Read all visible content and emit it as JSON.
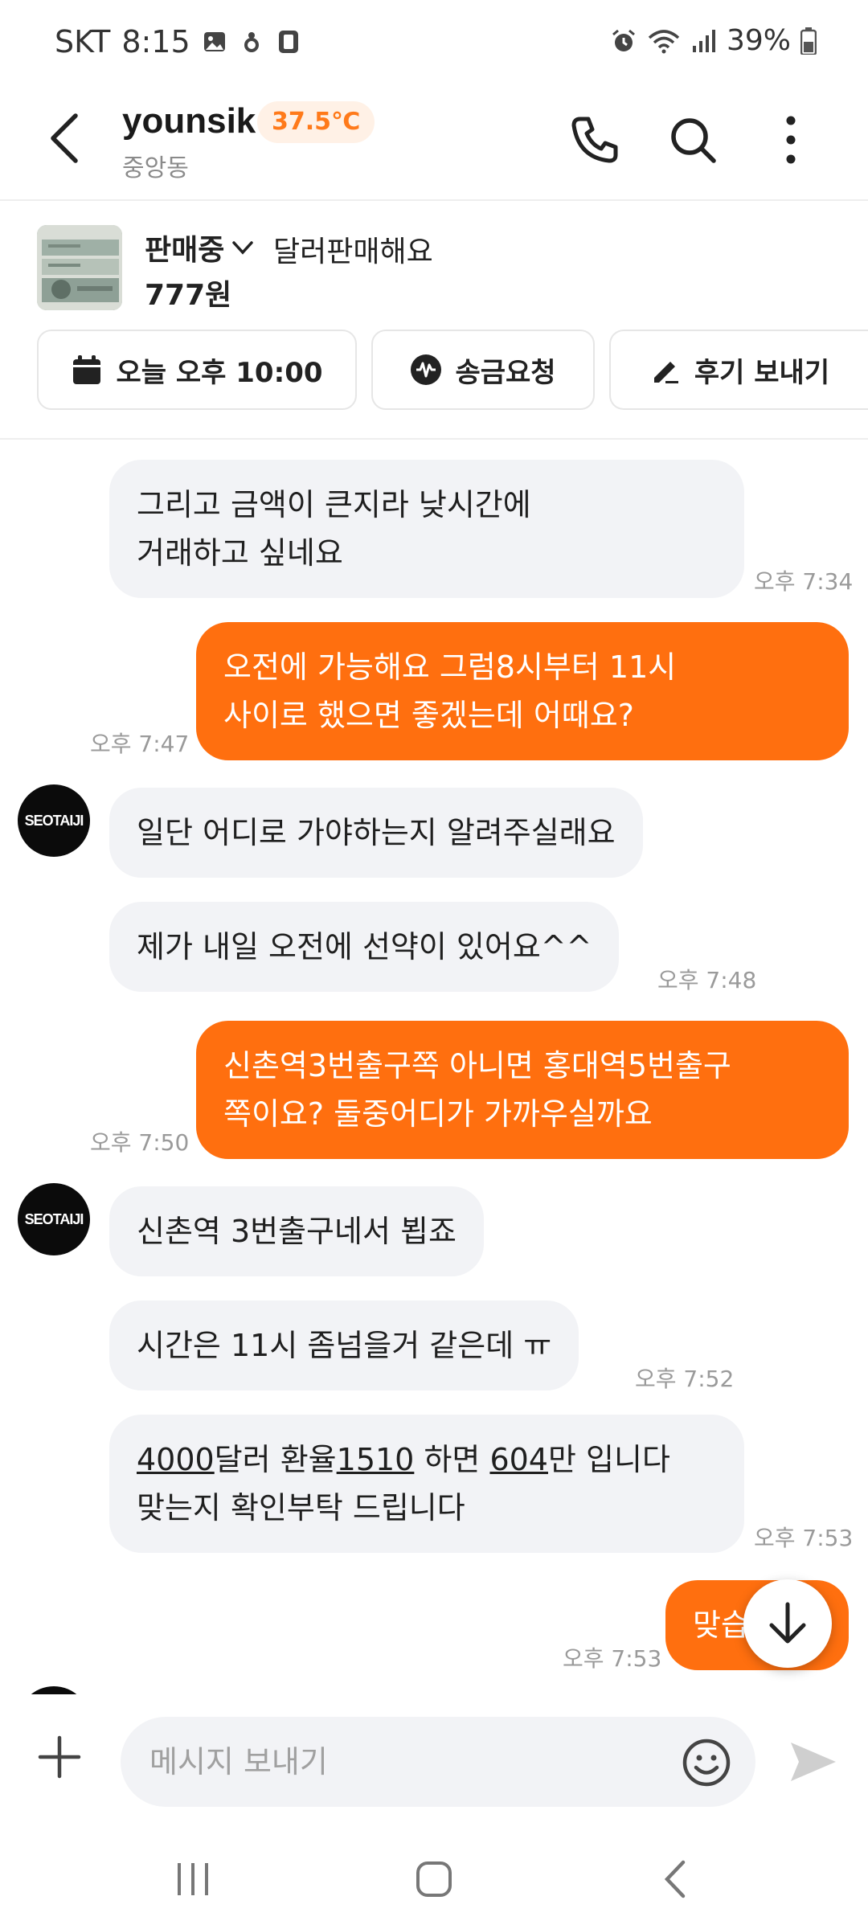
{
  "status_bar": {
    "carrier": "SKT",
    "time": "8:15",
    "battery": "39%"
  },
  "header": {
    "user_name": "younsik",
    "manner_temp": "37.5℃",
    "location": "중앙동"
  },
  "product": {
    "status": "판매중",
    "title": "달러판매해요",
    "price": "777원"
  },
  "actions": {
    "schedule": "오늘 오후 10:00",
    "remit": "송금요청",
    "review": "후기 보내기"
  },
  "avatar_label": "SEOTAIJI",
  "messages": [
    {
      "line1": "그리고 금액이 큰지라 낮시간에",
      "line2": "거래하고 싶네요",
      "time": "오후 7:34"
    },
    {
      "line1": "오전에 가능해요 그럼8시부터 11시",
      "line2": "사이로 했으면 좋겠는데 어때요?",
      "time": "오후 7:47"
    },
    {
      "text": "일단 어디로 가야하는지 알려주실래요"
    },
    {
      "text": "제가 내일 오전에 선약이 있어요^^",
      "time": "오후 7:48"
    },
    {
      "line1": "신촌역3번출구쪽 아니면 홍대역5번출구",
      "line2": "쪽이요?  둘중어디가 가까우실까요",
      "time": "오후 7:50"
    },
    {
      "text": "신촌역 3번출구네서 뵙죠"
    },
    {
      "text": "시간은 11시 좀넘을거 같은데 ㅠ",
      "time": "오후 7:52"
    },
    {
      "n1": "4000",
      "t1": "달러 환율",
      "n2": "1510",
      "t2": " 하면 ",
      "n3": "604",
      "t3": "만 입니다",
      "line2": "맞는지 확인부탁 드립니다",
      "time": "오후 7:53"
    },
    {
      "text": "맞습니다",
      "time": "오후 7:53"
    }
  ],
  "input": {
    "placeholder": "메시지 보내기"
  },
  "colors": {
    "accent": "#ff6f0f",
    "incoming_bubble": "#f2f3f6",
    "badge_bg": "#fff1e6"
  },
  "icons": {
    "back": "arrow-left-icon",
    "call": "phone-icon",
    "search": "search-icon",
    "more": "more-vertical-icon",
    "calendar": "calendar-icon",
    "remit": "won-pay-icon",
    "review": "pencil-icon",
    "plus": "plus-icon",
    "emoji": "smiley-icon",
    "send": "send-icon",
    "scroll": "arrow-down-icon"
  }
}
